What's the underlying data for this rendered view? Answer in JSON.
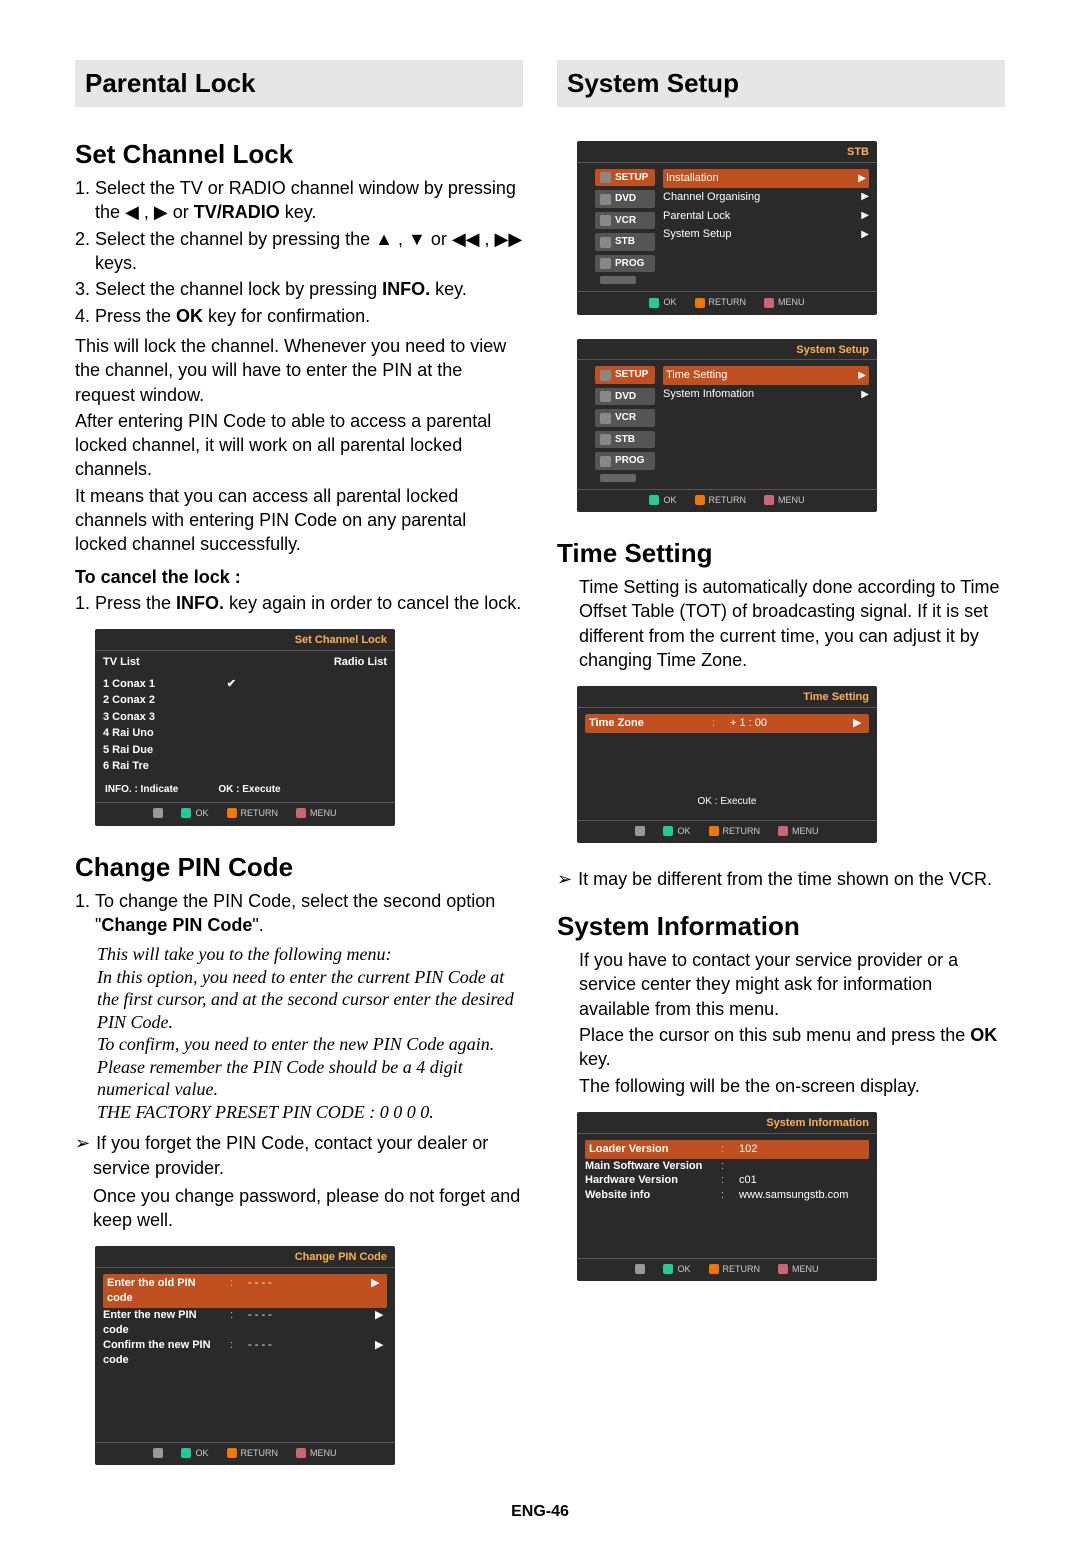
{
  "header_left": "Parental Lock",
  "header_right": "System Setup",
  "left": {
    "set_channel_lock": {
      "title": "Set Channel Lock",
      "steps": [
        "Select the TV or RADIO channel window by pressing the ◀ , ▶ or ",
        "Select the channel by pressing the ▲ , ▼ or ◀◀ , ▶▶ keys.",
        "Select the channel lock by pressing ",
        "Press the "
      ],
      "step1_tail": " key.",
      "step1_bold": "TV/RADIO",
      "step3_bold": "INFO.",
      "step3_tail": " key.",
      "step4_bold": "OK",
      "step4_tail": " key for confirmation.",
      "para1": "This will lock the channel. Whenever you need to view the channel, you will have to enter the PIN at the request window.",
      "para2": "After entering PIN Code to able to access a parental locked channel, it will work on all parental locked channels.",
      "para3": "It means that you can access all parental locked channels with entering PIN Code on any parental locked channel successfully.",
      "cancel_title": "To cancel the lock :",
      "cancel_step_a": "Press the ",
      "cancel_bold": "INFO.",
      "cancel_step_b": " key again in order to cancel the lock."
    },
    "osd_channel_lock": {
      "title": "Set Channel Lock",
      "col1": "TV List",
      "col2": "Radio List",
      "tv_items": [
        "1 Conax 1",
        "2 Conax 2",
        "3 Conax 3",
        "4 Rai Uno",
        "5 Rai Due",
        "6 Rai Tre"
      ],
      "footer_left": "INFO. : Indicate",
      "footer_right": "OK : Execute",
      "legend_ok": "OK",
      "legend_return": "RETURN",
      "legend_menu": "MENU"
    },
    "change_pin": {
      "title": "Change PIN Code",
      "step_pre": "To change the PIN Code, select the second option \"",
      "step_bold": "Change PIN Code",
      "step_post": "\".",
      "italic": "This will take you to the following menu:\nIn this option, you need to enter the current PIN Code at the first cursor, and at the second cursor enter the desired PIN Code.\nTo confirm, you need to enter the new PIN Code again.\nPlease remember the PIN Code should be a 4 digit numerical value.\nTHE FACTORY PRESET PIN CODE : 0 0 0 0.",
      "note1": "If you forget the PIN Code, contact your dealer or service provider.",
      "note2": "Once you change password, please do not forget and keep well."
    },
    "osd_pin": {
      "title": "Change PIN Code",
      "rows": [
        {
          "label": "Enter the old PIN code",
          "val": "- - - -"
        },
        {
          "label": "Enter the new PIN code",
          "val": "- - - -"
        },
        {
          "label": "Confirm the new PIN code",
          "val": "- - - -"
        }
      ],
      "legend_ok": "OK",
      "legend_return": "RETURN",
      "legend_menu": "MENU"
    }
  },
  "right": {
    "osd_stb": {
      "title": "STB",
      "side": [
        "SETUP",
        "DVD",
        "VCR",
        "STB",
        "PROG"
      ],
      "items": [
        "Installation",
        "Channel Organising",
        "Parental Lock",
        "System Setup"
      ]
    },
    "osd_system_setup": {
      "title": "System Setup",
      "side": [
        "SETUP",
        "DVD",
        "VCR",
        "STB",
        "PROG"
      ],
      "items": [
        "Time Setting",
        "System Infomation"
      ]
    },
    "time_setting": {
      "title": "Time Setting",
      "para": "Time Setting is automatically done according to Time Offset Table (TOT) of broadcasting signal. If it is set different from the current time, you can adjust it by changing Time Zone."
    },
    "osd_time": {
      "title": "Time Setting",
      "label": "Time Zone",
      "value": "+ 1 : 00",
      "ok": "OK : Execute"
    },
    "time_note": "It may be different from the time shown on the VCR.",
    "sys_info": {
      "title": "System Information",
      "para1": "If you have to contact your service provider or a service center they might ask for information available from this menu.",
      "para2a": "Place the cursor on this sub menu and press the ",
      "para2_bold": "OK",
      "para2b": " key.",
      "para3": "The following will be the on-screen display."
    },
    "osd_sysinfo": {
      "title": "System Information",
      "rows": [
        {
          "label": "Loader Version",
          "val": "102"
        },
        {
          "label": "Main Software Version",
          "val": ""
        },
        {
          "label": "Hardware Version",
          "val": "c01"
        },
        {
          "label": "Website info",
          "val": "www.samsungstb.com"
        }
      ]
    },
    "legend": {
      "ok": "OK",
      "return": "RETURN",
      "menu": "MENU"
    }
  },
  "page_num": "ENG-46"
}
